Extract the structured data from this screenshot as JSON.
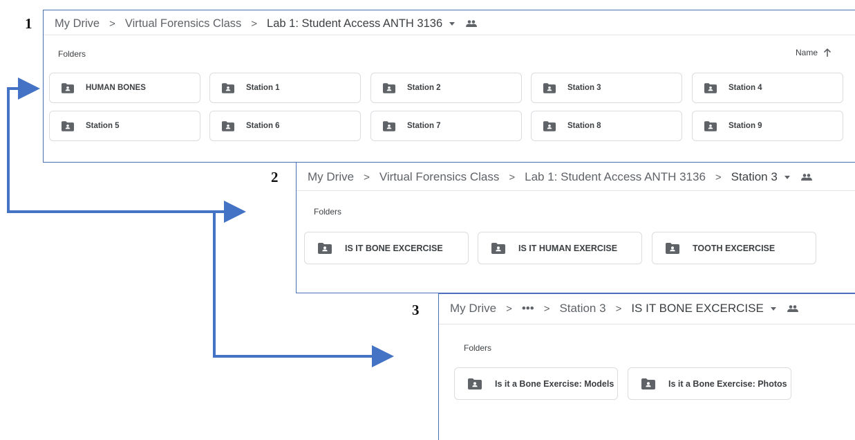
{
  "labels": [
    "1",
    "2",
    "3"
  ],
  "panel1": {
    "breadcrumb": [
      "My Drive",
      "Virtual Forensics Class",
      "Lab 1: Student Access ANTH 3136"
    ],
    "section": "Folders",
    "sort_label": "Name",
    "folders": [
      "HUMAN BONES",
      "Station 1",
      "Station 2",
      "Station 3",
      "Station 4",
      "Station 5",
      "Station 6",
      "Station 7",
      "Station 8",
      "Station 9"
    ]
  },
  "panel2": {
    "breadcrumb": [
      "My Drive",
      "Virtual Forensics Class",
      "Lab 1: Student Access ANTH 3136",
      "Station 3"
    ],
    "section": "Folders",
    "folders": [
      "IS IT BONE EXCERCISE",
      "IS IT HUMAN EXERCISE",
      "TOOTH EXCERCISE"
    ]
  },
  "panel3": {
    "breadcrumb": [
      "My Drive",
      "•••",
      "Station 3",
      "IS IT BONE EXCERCISE"
    ],
    "section": "Folders",
    "folders": [
      "Is it a Bone Exercise: Models",
      "Is it a Bone Exercise: Photos"
    ]
  },
  "colors": {
    "arrow": "#4472c4",
    "panel_border": "#4a6fb8",
    "folder_icon": "#5f6368"
  }
}
